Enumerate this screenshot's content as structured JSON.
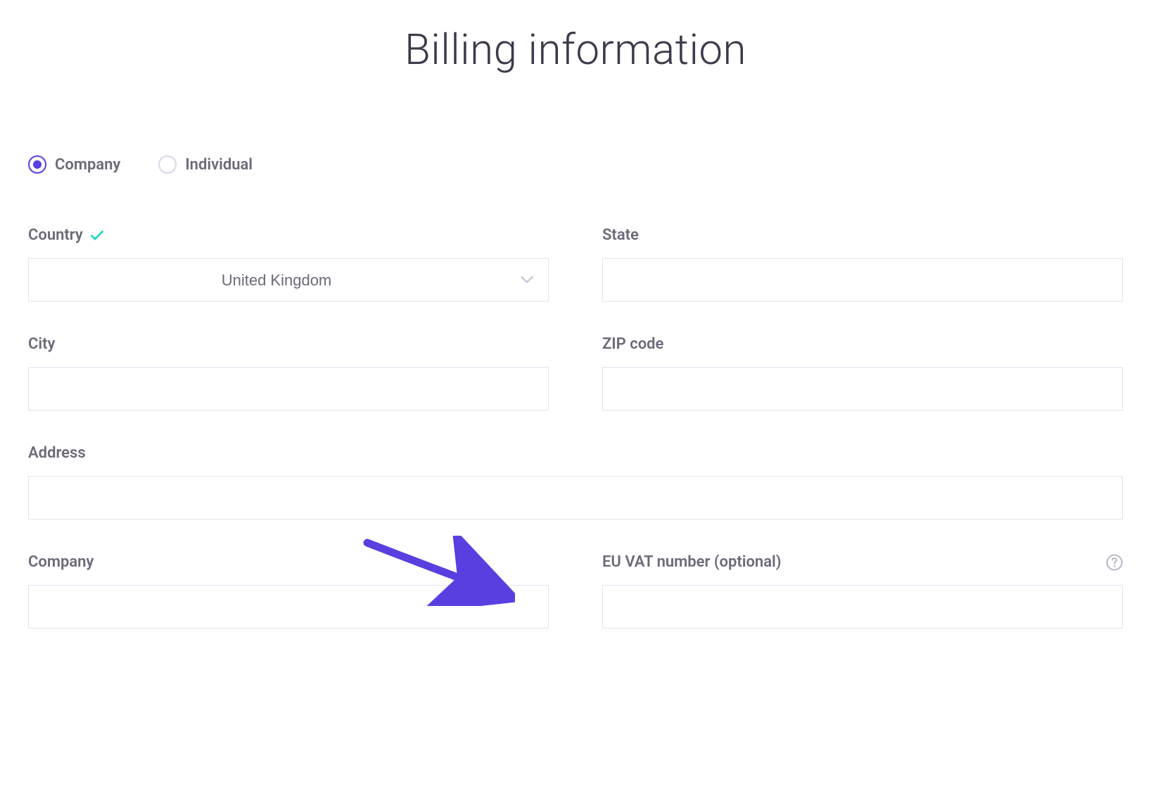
{
  "page": {
    "title": "Billing information"
  },
  "account_type": {
    "company_label": "Company",
    "individual_label": "Individual",
    "selected": "company"
  },
  "fields": {
    "country": {
      "label": "Country",
      "value": "United Kingdom",
      "validated": true
    },
    "state": {
      "label": "State",
      "value": ""
    },
    "city": {
      "label": "City",
      "value": ""
    },
    "zip": {
      "label": "ZIP code",
      "value": ""
    },
    "address": {
      "label": "Address",
      "value": ""
    },
    "company": {
      "label": "Company",
      "value": ""
    },
    "vat": {
      "label": "EU VAT number (optional)",
      "value": ""
    }
  },
  "colors": {
    "accent": "#5a3fe0",
    "checkmark": "#2dd4c5",
    "text_muted": "#6a6a78",
    "border": "#e4e2ef"
  }
}
